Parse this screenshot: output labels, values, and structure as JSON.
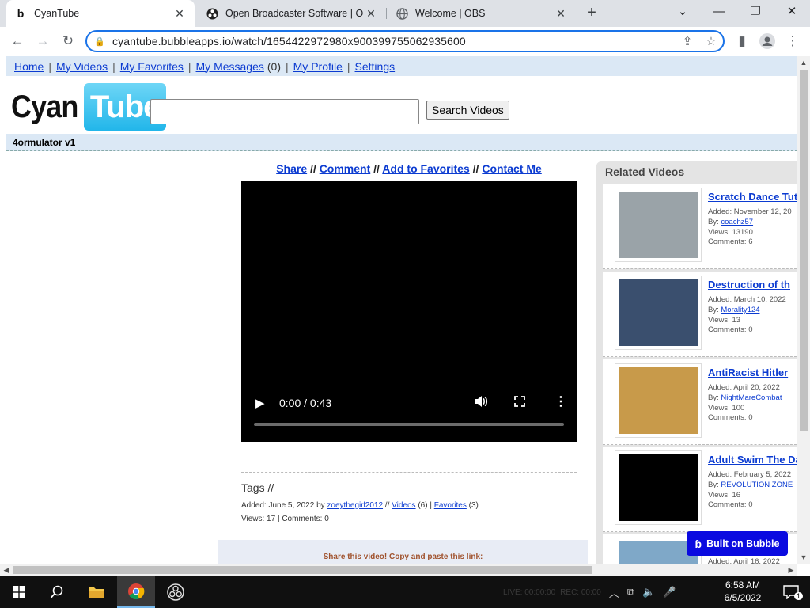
{
  "browser": {
    "tabs": [
      {
        "title": "CyanTube",
        "icon": "bubble-b-icon",
        "active": true
      },
      {
        "title": "Open Broadcaster Software | OBS",
        "icon": "obs-icon",
        "active": false
      },
      {
        "title": "Welcome | OBS",
        "icon": "globe-icon",
        "active": false
      }
    ],
    "url": "cyantube.bubbleapps.io/watch/1654422972980x900399755062935600"
  },
  "site": {
    "nav": [
      {
        "label": "Home"
      },
      {
        "label": "My Videos"
      },
      {
        "label": "My Favorites"
      },
      {
        "label": "My Messages",
        "count": "(0)"
      },
      {
        "label": "My Profile"
      },
      {
        "label": "Settings"
      }
    ],
    "logo": {
      "part1": "Cyan",
      "part2": "Tube"
    },
    "search": {
      "value": "",
      "button": "Search Videos"
    },
    "video_title": "4ormulator v1",
    "actions": {
      "share": "Share",
      "comment": "Comment",
      "favorite": "Add to Favorites",
      "contact": "Contact Me",
      "sep": "//"
    },
    "player": {
      "time": "0:00 / 0:43",
      "progress": 0
    },
    "tags": "Tags //",
    "meta": {
      "added": "Added: June 5, 2022 by",
      "user": "zoeythegirl2012",
      "videos_link": "Videos",
      "videos_count": "(6)",
      "favorites_link": "Favorites",
      "favorites_count": "(3)",
      "views_comments": "Views: 17 | Comments: 0"
    },
    "share_box": "Share this video! Copy and paste this link:",
    "related": {
      "title": "Related Videos",
      "items": [
        {
          "title": "Scratch Dance Tut",
          "added": "Added: November 12, 20",
          "by_label": "By:",
          "by": "coachz57",
          "views": "Views: 13190",
          "comments": "Comments: 6",
          "thumb_color": "#9aa3a8"
        },
        {
          "title": "Destruction of th",
          "added": "Added: March 10, 2022",
          "by_label": "By:",
          "by": "Morality124",
          "views": "Views: 13",
          "comments": "Comments: 0",
          "thumb_color": "#3a4f6e"
        },
        {
          "title": "AntiRacist Hitler",
          "added": "Added: April 20, 2022",
          "by_label": "By:",
          "by": "NightMareCombat",
          "views": "Views: 100",
          "comments": "Comments: 0",
          "thumb_color": "#c89a4a"
        },
        {
          "title": "Adult Swim The Da",
          "added": "Added: February 5, 2022",
          "by_label": "By:",
          "by": "REVOLUTION ZONE",
          "views": "Views: 16",
          "comments": "Comments: 0",
          "thumb_color": "#000000"
        },
        {
          "title": "",
          "added": "Added: April 16, 2022",
          "by_label": "",
          "by": "",
          "views": "",
          "comments": "",
          "thumb_color": "#7fa8c8"
        }
      ]
    },
    "bubble_badge": "Built on Bubble"
  },
  "taskbar": {
    "time": "6:58 AM",
    "date": "6/5/2022",
    "live": "LIVE: 00:00:00",
    "rec": "REC: 00:00",
    "notifications": "1"
  }
}
